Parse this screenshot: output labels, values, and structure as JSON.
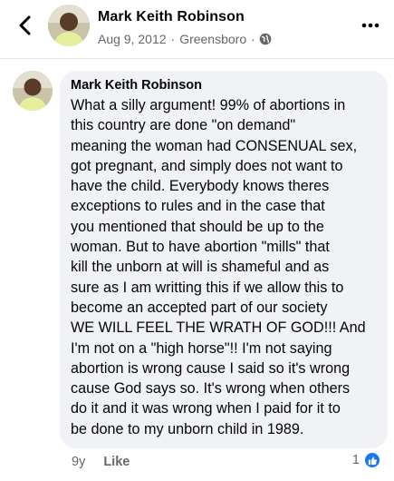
{
  "header": {
    "name": "Mark Keith Robinson",
    "date": "Aug 9, 2012",
    "location": "Greensboro",
    "privacy_icon": "globe-icon"
  },
  "comment": {
    "author": "Mark Keith Robinson",
    "text": "What a silly argument! 99% of abortions in\nthis country are done \"on demand\"\nmeaning the woman had CONSENUAL sex,\ngot pregnant, and simply does not want to\nhave the child. Everybody knows theres\nexceptions to rules and in the case that\nyou mentioned that should be up to the\nwoman. But to have abortion \"mills\" that\nkill the unborn at will is shameful and as\nsure as I am writting this if we allow this to\nbecome an accepted part of our society\nWE WILL FEEL THE WRATH OF GOD!!! And\nI'm not on a \"high horse\"!!  I'm not saying\nabortion is wrong cause I said so it's wrong\ncause God says so. It's wrong when others\ndo it and it was wrong when I paid for it to\nbe done to my unborn child in 1989.",
    "age": "9y",
    "like_label": "Like",
    "reaction_count": "1"
  },
  "colors": {
    "bubble": "#f0f2f5",
    "secondary_text": "#65676b",
    "like_blue": "#1877f2"
  }
}
